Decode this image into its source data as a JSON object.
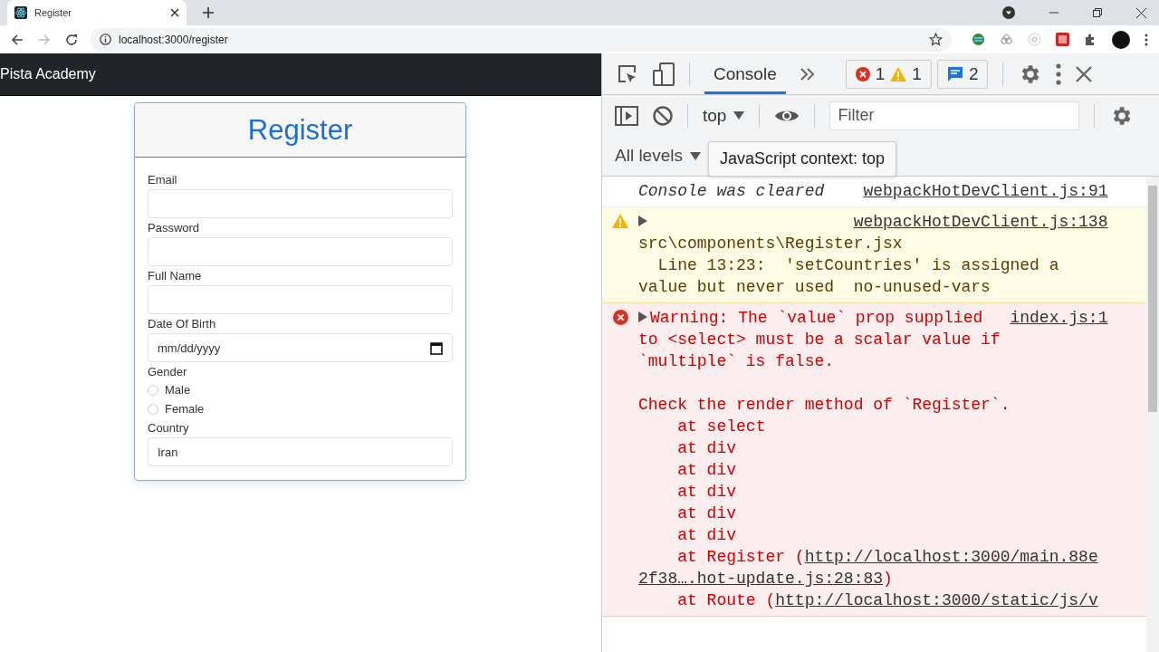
{
  "browser": {
    "tab": {
      "title": "Register"
    },
    "address": "localhost:3000/register",
    "forward_disabled": true
  },
  "page": {
    "brand": "Pista Academy",
    "form": {
      "title": "Register",
      "fields": [
        {
          "kind": "text",
          "label": "Email"
        },
        {
          "kind": "text",
          "label": "Password"
        },
        {
          "kind": "text",
          "label": "Full Name"
        },
        {
          "kind": "date",
          "label": "Date Of Birth",
          "placeholder": "mm/dd/yyyy"
        },
        {
          "kind": "radio",
          "label": "Gender",
          "options": [
            {
              "label": "Male",
              "selected": false
            },
            {
              "label": "Female",
              "selected": false
            }
          ]
        },
        {
          "kind": "text",
          "label": "Country",
          "value": "Iran"
        }
      ]
    }
  },
  "devtools": {
    "tabs": [
      {
        "label": "Console",
        "selected": true
      }
    ],
    "counts": {
      "errors": "1",
      "warnings": "1",
      "messages": "2"
    },
    "context": "top",
    "filter": {
      "placeholder": "Filter"
    },
    "levels": "All levels",
    "tooltip": "JavaScript context: top",
    "messages": [
      {
        "kind": "info",
        "text": "Console was cleared",
        "source": "webpackHotDevClient.js:91"
      },
      {
        "kind": "warning",
        "source": "webpackHotDevClient.js:138",
        "detail": "src\\components\\Register.jsx\n  Line 13:23:  'setCountries' is assigned a\nvalue but never used  no-unused-vars"
      },
      {
        "kind": "error",
        "source": "index.js:1",
        "text": "Warning: The `value` prop supplied",
        "detail": "to <select> must be a scalar value if\n`multiple` is false.\n\nCheck the render method of `Register`.",
        "stack": [
          {
            "text": "    at select"
          },
          {
            "text": "    at div"
          },
          {
            "text": "    at div"
          },
          {
            "text": "    at div"
          },
          {
            "text": "    at div"
          },
          {
            "text": "    at div"
          },
          {
            "text": "    at Register (",
            "link": "http://localhost:3000/main.88e"
          },
          {
            "link": "2f38….hot-update.js:28:83",
            "after": ")"
          },
          {
            "text": "    at Route (",
            "link": "http://localhost:3000/static/js/v"
          }
        ]
      }
    ]
  }
}
